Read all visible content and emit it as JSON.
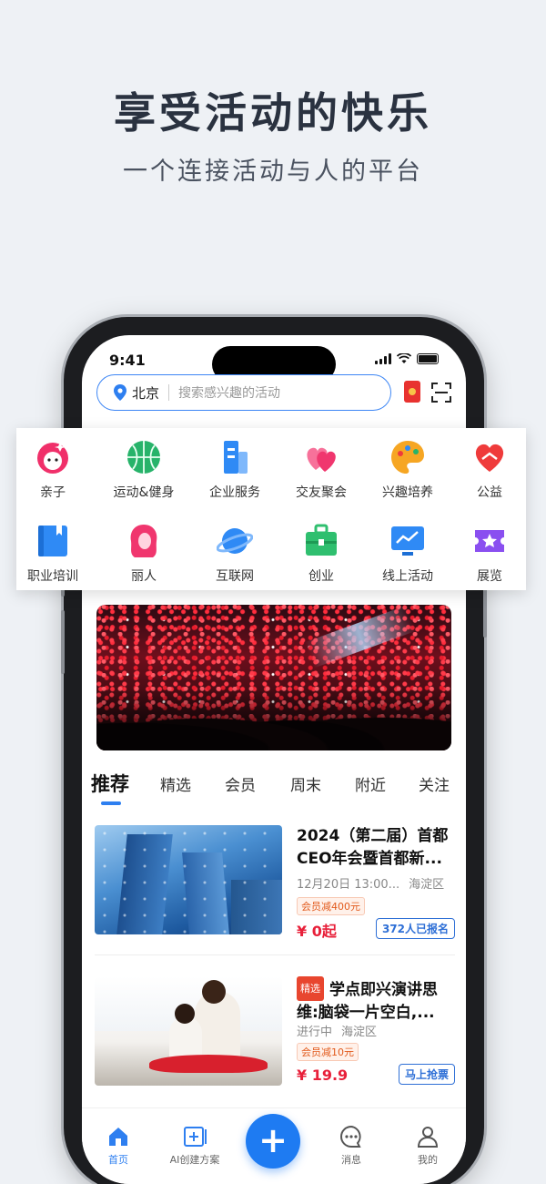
{
  "hero": {
    "title": "享受活动的快乐",
    "subtitle": "一个连接活动与人的平台"
  },
  "status_bar": {
    "time": "9:41"
  },
  "search": {
    "city": "北京",
    "placeholder": "搜索感兴趣的活动"
  },
  "categories": [
    {
      "label": "亲子",
      "icon": "kids-face-icon",
      "color": "#f0306a"
    },
    {
      "label": "运动&健身",
      "icon": "basketball-icon",
      "color": "#27b36a"
    },
    {
      "label": "企业服务",
      "icon": "building-icon",
      "color": "#2f8af5"
    },
    {
      "label": "交友聚会",
      "icon": "hearts-icon",
      "color": "#f0366e"
    },
    {
      "label": "兴趣培养",
      "icon": "palette-icon",
      "color": "#f6a623"
    },
    {
      "label": "公益",
      "icon": "heart-hands-icon",
      "color": "#ef3b3b"
    },
    {
      "label": "职业培训",
      "icon": "book-icon",
      "color": "#2f8af5"
    },
    {
      "label": "丽人",
      "icon": "woman-icon",
      "color": "#f0366e"
    },
    {
      "label": "互联网",
      "icon": "planet-icon",
      "color": "#2f8af5"
    },
    {
      "label": "创业",
      "icon": "briefcase-icon",
      "color": "#2fbf6f"
    },
    {
      "label": "线上活动",
      "icon": "screen-chart-icon",
      "color": "#2f8af5"
    },
    {
      "label": "展览",
      "icon": "ticket-star-icon",
      "color": "#8a4ff0"
    }
  ],
  "tabs": [
    "推荐",
    "精选",
    "会员",
    "周末",
    "附近",
    "关注"
  ],
  "events": [
    {
      "title": "2024（第二届）首都CEO年会暨首都新...",
      "time": "12月20日 13:00...",
      "district": "海淀区",
      "coupon": "会员减400元",
      "price": "¥ 0起",
      "action": "372人已报名"
    },
    {
      "badge": "精选",
      "title": "学点即兴演讲思维:脑袋一片空白,...",
      "time": "进行中",
      "district": "海淀区",
      "coupon": "会员减10元",
      "price": "¥ 19.9",
      "action": "马上抢票"
    }
  ],
  "bottom_nav": {
    "home": "首页",
    "ai_plan": "AI创建方案",
    "plus": "+",
    "messages": "消息",
    "mine": "我的"
  },
  "colors": {
    "accent": "#2e7ff0",
    "price": "#e8203a",
    "title": "#2a3240"
  }
}
